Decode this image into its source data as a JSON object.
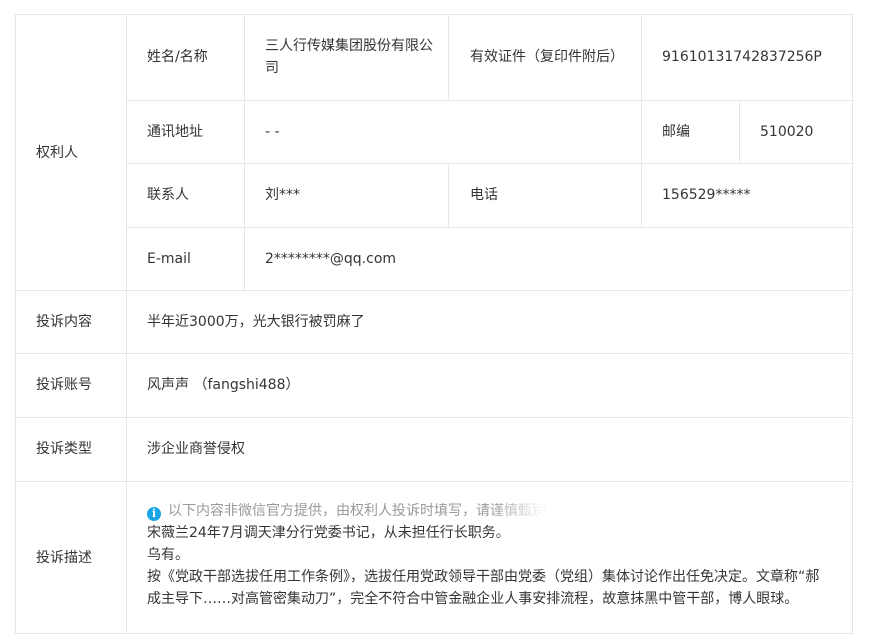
{
  "rights_holder": {
    "section_label": "权利人",
    "name_label": "姓名/名称",
    "name_value": "三人行传媒集团股份有限公司",
    "id_label": "有效证件（复印件附后）",
    "id_value": "91610131742837256P",
    "address_label": "通讯地址",
    "address_value": "- -",
    "postcode_label": "邮编",
    "postcode_value": "510020",
    "contact_label": "联系人",
    "contact_value": "刘***",
    "phone_label": "电话",
    "phone_value": "156529*****",
    "email_label": "E-mail",
    "email_value": "2********@qq.com"
  },
  "complaint": {
    "content_label": "投诉内容",
    "content_value": "半年近3000万，光大银行被罚麻了",
    "account_label": "投诉账号",
    "account_value": "风声声 （fangshi488）",
    "type_label": "投诉类型",
    "type_value": "涉企业商誉侵权",
    "desc_label": "投诉描述",
    "notice_icon": "info-icon",
    "notice_text": "以下内容非微信官方提供，由权利人投诉时填写，请谨慎甄别",
    "desc_lines": [
      "宋薇兰24年7月调天津分行党委书记，从未担任行长职务。",
      "乌有。",
      "按《党政干部选拔任用工作条例》，选拔任用党政领导干部由党委（党组）集体讨论作出任免决定。文章称“郝",
      "成主导下……对高管密集动刀”，完全不符合中管金融企业人事安排流程，故意抹黑中管干部，博人眼球。"
    ]
  },
  "colors": {
    "border": "#e7e7e7",
    "text": "#353535",
    "notice": "#9a9a9a",
    "icon": "#1aa4e8"
  }
}
